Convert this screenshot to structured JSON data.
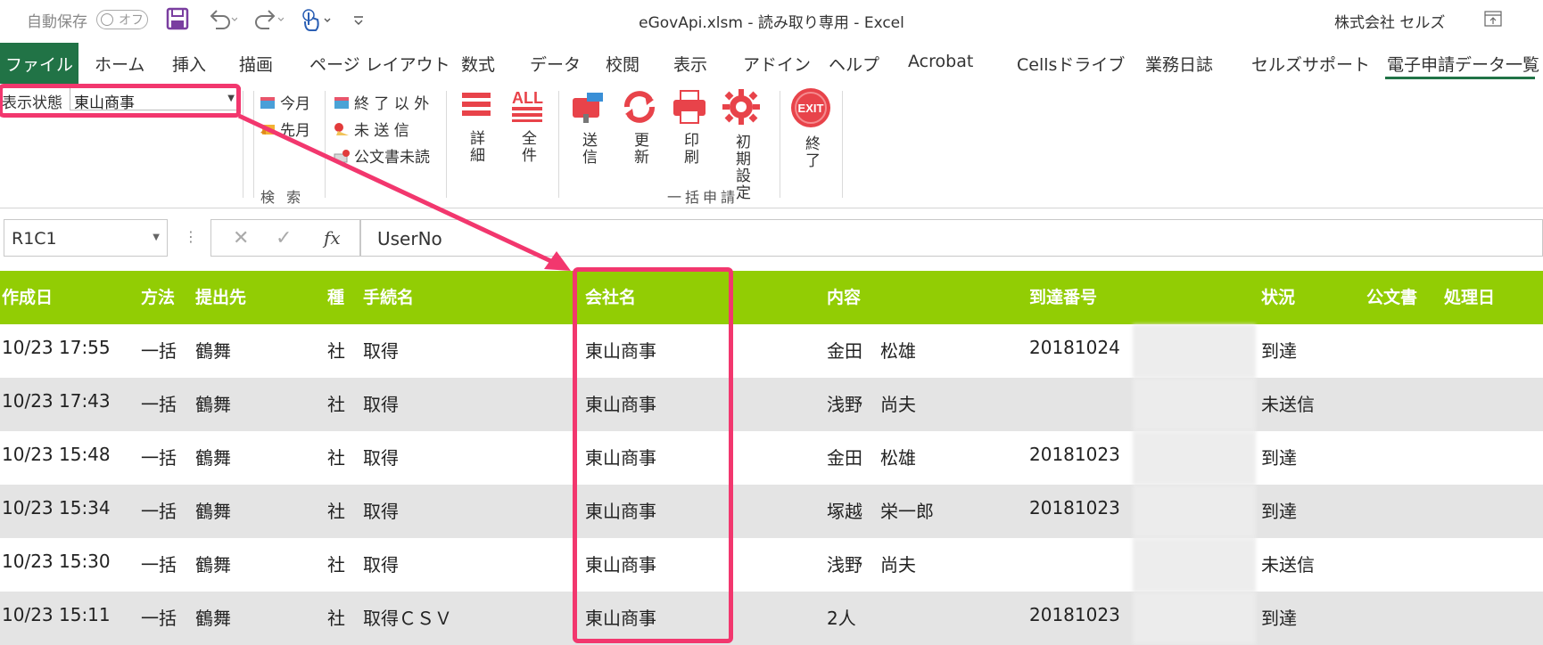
{
  "titlebar": {
    "autosave_label": "自動保存",
    "autosave_state": "オフ",
    "title": "eGovApi.xlsm  -  読み取り専用  -  Excel",
    "user": "株式会社 セルズ"
  },
  "tabs": [
    {
      "label": "ファイル"
    },
    {
      "label": "ホーム"
    },
    {
      "label": "挿入"
    },
    {
      "label": "描画"
    },
    {
      "label": "ページ レイアウト"
    },
    {
      "label": "数式"
    },
    {
      "label": "データ"
    },
    {
      "label": "校閲"
    },
    {
      "label": "表示"
    },
    {
      "label": "アドイン"
    },
    {
      "label": "ヘルプ"
    },
    {
      "label": "Acrobat"
    },
    {
      "label": "Cellsドライブ"
    },
    {
      "label": "業務日誌"
    },
    {
      "label": "セルズサポート"
    },
    {
      "label": "電子申請データ一覧"
    }
  ],
  "ribbon": {
    "filter_label": "表示状態",
    "filter_value": "東山商事",
    "this_month": "今月",
    "last_month": "先月",
    "search_group": "検 索",
    "except_done": "終 了 以 外",
    "unsent": "未 送 信",
    "unread_doc": "公文書未読",
    "detail": "詳細",
    "all": "全件",
    "send": "送信",
    "refresh": "更新",
    "print": "印刷",
    "init_settings": "初期設定",
    "batch_group": "一括申請",
    "exit": "終了",
    "exit_icon_text": "EXIT",
    "all_icon_text": "ALL"
  },
  "formula_bar": {
    "name_box": "R1C1",
    "fx": "fx",
    "value": "UserNo"
  },
  "table": {
    "headers": [
      "作成日",
      "方法",
      "提出先",
      "種",
      "手続名",
      "会社名",
      "内容",
      "到達番号",
      "状況",
      "公文書",
      "処理日"
    ],
    "rows": [
      [
        "10/23 17:55",
        "一括",
        "鶴舞",
        "社",
        "取得",
        "東山商事",
        "金田　松雄",
        "20181024",
        "到達"
      ],
      [
        "10/23 17:43",
        "一括",
        "鶴舞",
        "社",
        "取得",
        "東山商事",
        "浅野　尚夫",
        "",
        "未送信"
      ],
      [
        "10/23 15:48",
        "一括",
        "鶴舞",
        "社",
        "取得",
        "東山商事",
        "金田　松雄",
        "20181023",
        "到達"
      ],
      [
        "10/23 15:34",
        "一括",
        "鶴舞",
        "社",
        "取得",
        "東山商事",
        "塚越　栄一郎",
        "20181023",
        "到達"
      ],
      [
        "10/23 15:30",
        "一括",
        "鶴舞",
        "社",
        "取得",
        "東山商事",
        "浅野　尚夫",
        "",
        "未送信"
      ],
      [
        "10/23 15:11",
        "一括",
        "鶴舞",
        "社",
        "取得ＣＳＶ",
        "東山商事",
        "2人",
        "20181023",
        "到達"
      ]
    ]
  },
  "colors": {
    "excel_green": "#217346",
    "header_green": "#92cd04",
    "annotation_pink": "#f2376e",
    "row_alt": "#e4e4e4"
  }
}
